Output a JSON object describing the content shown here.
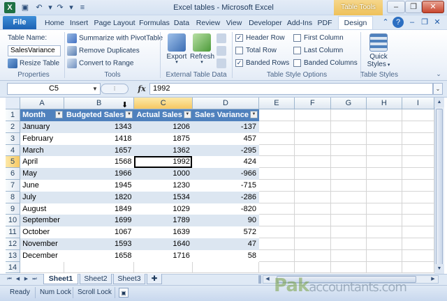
{
  "window": {
    "title": "Excel tables  -  Microsoft Excel",
    "context_tab": "Table Tools",
    "minimize": "–",
    "restore": "❐",
    "close": "✕",
    "help_icons": [
      "⌃",
      "?",
      "–",
      "❐",
      "✕"
    ]
  },
  "ribbon": {
    "file_tab": "File",
    "tabs": [
      "Home",
      "Insert",
      "Page Layout",
      "Formulas",
      "Data",
      "Review",
      "View",
      "Developer",
      "Add-Ins",
      "PDF"
    ],
    "active_tab": "Design",
    "properties": {
      "table_name_label": "Table Name:",
      "table_name_value": "SalesVariance",
      "resize_label": "Resize Table",
      "group_label": "Properties"
    },
    "tools": {
      "summarize": "Summarize with PivotTable",
      "remove_duplicates": "Remove Duplicates",
      "convert_range": "Convert to Range",
      "group_label": "Tools"
    },
    "external": {
      "export": "Export",
      "refresh": "Refresh",
      "group_label": "External Table Data"
    },
    "style_options": {
      "header_row": "Header Row",
      "total_row": "Total Row",
      "banded_rows": "Banded Rows",
      "first_column": "First Column",
      "last_column": "Last Column",
      "banded_columns": "Banded Columns",
      "group_label": "Table Style Options"
    },
    "styles": {
      "quick_styles": "Quick",
      "quick_styles_2": "Styles",
      "group_label": "Table Styles"
    }
  },
  "formula_bar": {
    "name_box": "C5",
    "fx": "fx",
    "value": "1992"
  },
  "grid": {
    "columns": [
      "A",
      "B",
      "C",
      "D",
      "E",
      "F",
      "G",
      "H",
      "I"
    ],
    "selected_column": "C",
    "selected_row": "5",
    "rows": [
      "1",
      "2",
      "3",
      "4",
      "5",
      "6",
      "7",
      "8",
      "9",
      "10",
      "11",
      "12",
      "13",
      "14"
    ],
    "table_headers": [
      "Month",
      "Budgeted Sales",
      "Actual Sales",
      "Sales Variance"
    ],
    "table_rows": [
      [
        "January",
        "1343",
        "1206",
        "-137"
      ],
      [
        "February",
        "1418",
        "1875",
        "457"
      ],
      [
        "March",
        "1657",
        "1362",
        "-295"
      ],
      [
        "April",
        "1568",
        "1992",
        "424"
      ],
      [
        "May",
        "1966",
        "1000",
        "-966"
      ],
      [
        "June",
        "1945",
        "1230",
        "-715"
      ],
      [
        "July",
        "1820",
        "1534",
        "-286"
      ],
      [
        "August",
        "1849",
        "1029",
        "-820"
      ],
      [
        "September",
        "1699",
        "1789",
        "90"
      ],
      [
        "October",
        "1067",
        "1639",
        "572"
      ],
      [
        "November",
        "1593",
        "1640",
        "47"
      ],
      [
        "December",
        "1658",
        "1716",
        "58"
      ]
    ],
    "band_color": "#dce6f1",
    "header_color": "#4f81bd"
  },
  "sheets": {
    "tabs": [
      "Sheet1",
      "Sheet2",
      "Sheet3"
    ],
    "active": "Sheet1"
  },
  "status": {
    "ready": "Ready",
    "num_lock": "Num Lock",
    "scroll_lock": "Scroll Lock"
  },
  "watermark": {
    "brand": "Pak",
    "suffix": "accountants.com"
  }
}
